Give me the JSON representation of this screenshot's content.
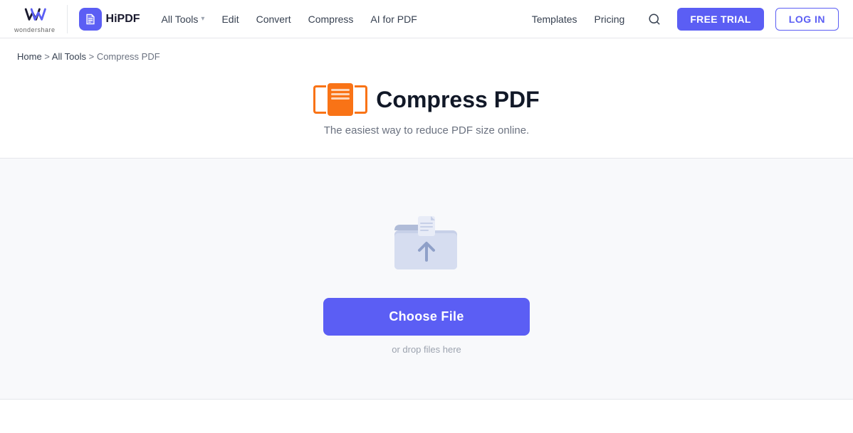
{
  "brand": {
    "wondershare_text": "wondershare",
    "hipdf_name": "HiPDF"
  },
  "nav": {
    "all_tools_label": "All Tools",
    "edit_label": "Edit",
    "convert_label": "Convert",
    "compress_label": "Compress",
    "ai_for_pdf_label": "AI for PDF",
    "templates_label": "Templates",
    "pricing_label": "Pricing",
    "free_trial_label": "FREE TRIAL",
    "login_label": "LOG IN"
  },
  "breadcrumb": {
    "home": "Home",
    "separator1": " > ",
    "all_tools": "All Tools",
    "separator2": " > ",
    "current": "Compress PDF"
  },
  "hero": {
    "title": "Compress PDF",
    "subtitle": "The easiest way to reduce PDF size online."
  },
  "dropzone": {
    "choose_file_label": "Choose File",
    "drop_hint": "or drop files here"
  }
}
